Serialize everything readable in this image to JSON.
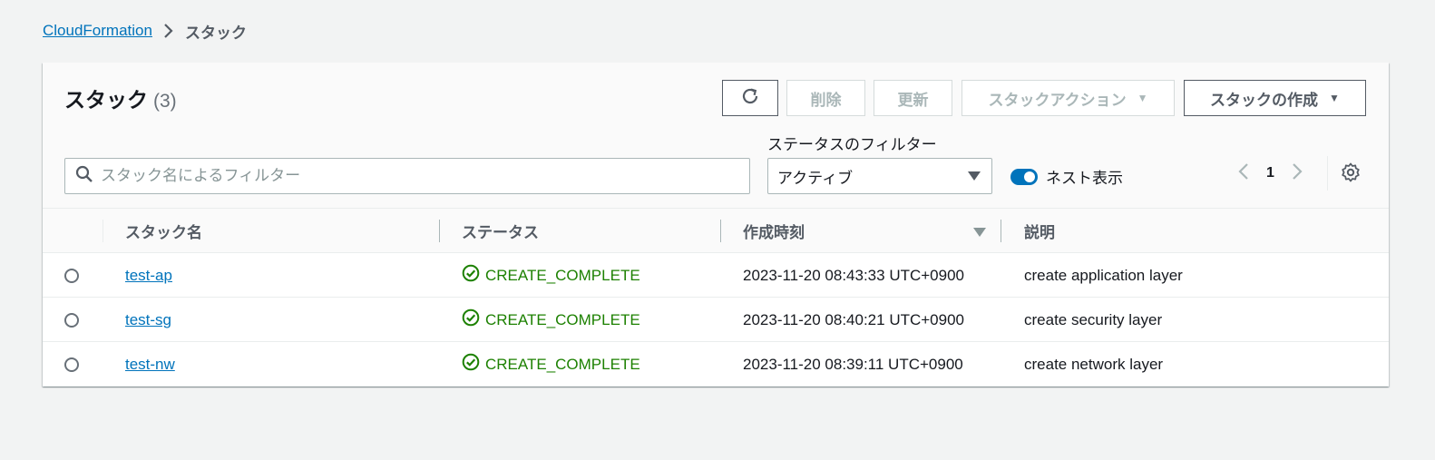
{
  "breadcrumb": {
    "root": "CloudFormation",
    "current": "スタック"
  },
  "panel": {
    "title": "スタック",
    "count": "(3)",
    "buttons": {
      "delete": "削除",
      "update": "更新",
      "stack_actions": "スタックアクション",
      "create_stack": "スタックの作成"
    },
    "search": {
      "placeholder": "スタック名によるフィルター",
      "value": ""
    },
    "status_filter": {
      "label": "ステータスのフィルター",
      "selected": "アクティブ"
    },
    "nested_toggle": {
      "label": "ネスト表示",
      "on": true
    },
    "pagination": {
      "page": "1"
    }
  },
  "table": {
    "headers": {
      "name": "スタック名",
      "status": "ステータス",
      "created": "作成時刻",
      "description": "説明"
    },
    "rows": [
      {
        "name": "test-ap",
        "status": "CREATE_COMPLETE",
        "created": "2023-11-20 08:43:33 UTC+0900",
        "description": "create application layer"
      },
      {
        "name": "test-sg",
        "status": "CREATE_COMPLETE",
        "created": "2023-11-20 08:40:21 UTC+0900",
        "description": "create security layer"
      },
      {
        "name": "test-nw",
        "status": "CREATE_COMPLETE",
        "created": "2023-11-20 08:39:11 UTC+0900",
        "description": "create network layer"
      }
    ]
  },
  "colors": {
    "link": "#0073bb",
    "success": "#1d8102",
    "toggle": "#0073bb"
  }
}
